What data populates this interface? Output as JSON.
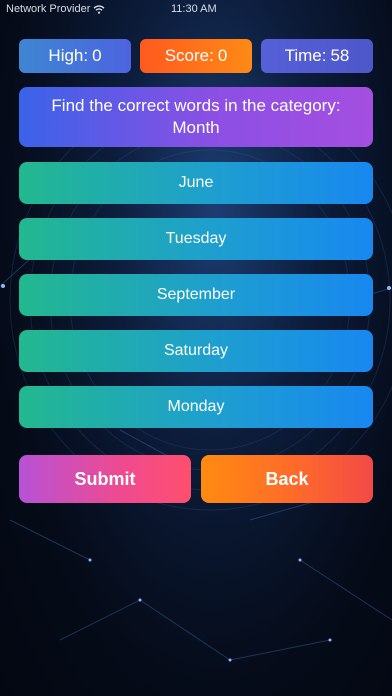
{
  "status_bar": {
    "carrier": "Network Provider",
    "wifi_icon": "wifi-icon",
    "time": "11:30 AM"
  },
  "stats": {
    "high": {
      "label": "High:",
      "value": "0"
    },
    "score": {
      "label": "Score:",
      "value": "0"
    },
    "time": {
      "label": "Time:",
      "value": "58"
    }
  },
  "question": {
    "line1": "Find the correct words in the category:",
    "category": "Month"
  },
  "options": [
    "June",
    "Tuesday",
    "September",
    "Saturday",
    "Monday"
  ],
  "buttons": {
    "submit": "Submit",
    "back": "Back"
  },
  "colors": {
    "high_badge": "#4c64df",
    "score_badge": "#ff7a18",
    "time_badge": "#5660d8",
    "option_start": "#22b88f",
    "option_end": "#1888f0",
    "submit_start": "#b752d6",
    "back_start": "#ff8b10"
  }
}
